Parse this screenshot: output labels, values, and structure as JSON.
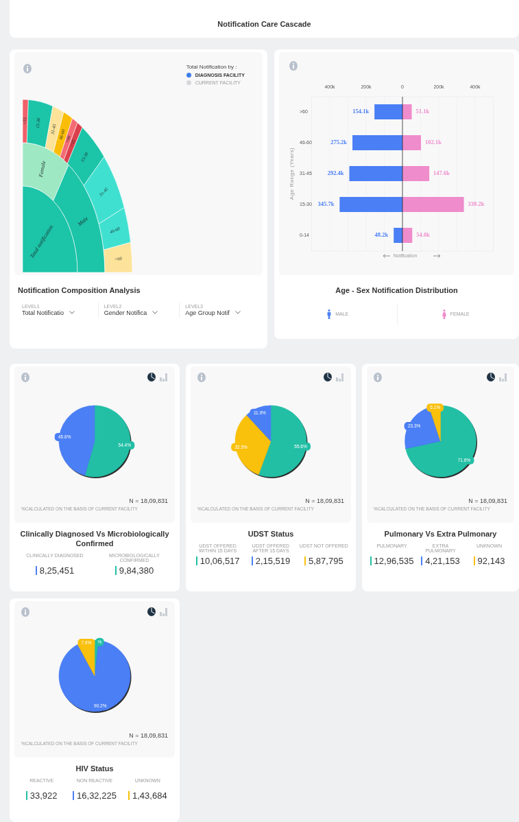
{
  "header": {
    "title": "Notification Care Cascade"
  },
  "composition": {
    "legend_title": "Total Notification by :",
    "legend": [
      {
        "label": "DIAGNOSIS FACILITY",
        "selected": true
      },
      {
        "label": "CURRENT FACILITY",
        "selected": false
      }
    ],
    "sunburst": {
      "rings": [
        [
          {
            "label": "Total notification",
            "color": "#1cc4a8"
          }
        ],
        [
          {
            "label": "Female",
            "color": "#9ee8c4"
          },
          {
            "label": "Male",
            "color": "#1cc4a8"
          }
        ],
        [
          {
            "label": "<15",
            "color": "#f2606a"
          },
          {
            "label": "15-30",
            "color": "#1cc4a8"
          },
          {
            "label": "31-45",
            "color": "#fde39a"
          },
          {
            "label": "46-60",
            "color": "#fbbd08"
          },
          {
            "label": ">60",
            "color": "#f36b74"
          },
          {
            "label": "<15",
            "color": "#dc3f4c"
          },
          {
            "label": "15-30",
            "color": "#1cc4a8"
          },
          {
            "label": "31-45",
            "color": "#40e0d0"
          },
          {
            "label": "46-60",
            "color": "#40e0d0"
          },
          {
            "label": ">60",
            "color": "#fde39a"
          }
        ]
      ]
    },
    "title": "Notification Composition Analysis",
    "selectors": [
      {
        "label": "LEVEL1",
        "value": "Total Notificatio"
      },
      {
        "label": "LEVEL2",
        "value": "Gender Notifica"
      },
      {
        "label": "LEVEL3",
        "value": "Age Group Notif"
      }
    ]
  },
  "age_sex": {
    "title": "Age - Sex Notification Distribution",
    "chart_data": {
      "type": "bar",
      "orientation": "horizontal",
      "xlabel": "Notification",
      "ylabel": "Age Range (Years)",
      "categories": [
        ">60",
        "46-60",
        "31-45",
        "15-30",
        "0-14"
      ],
      "stacked": true,
      "series": [
        {
          "name": "MALE",
          "color": "#4a7ff5",
          "values": [
            -154100,
            -275200,
            -292400,
            -345700,
            -48200
          ]
        },
        {
          "name": "FEMALE",
          "color": "#ef8ccb",
          "values": [
            51100,
            102100,
            147600,
            338200,
            54000
          ]
        }
      ],
      "xlim": [
        -500000,
        500000
      ],
      "xticks": [
        {
          "value": -400000,
          "label": "400k"
        },
        {
          "value": -200000,
          "label": "200k"
        },
        {
          "value": 0,
          "label": "0"
        },
        {
          "value": 200000,
          "label": "200k"
        },
        {
          "value": 400000,
          "label": "400k"
        }
      ]
    },
    "bar_labels": [
      {
        "male": "154.1k",
        "female": "51.1k"
      },
      {
        "male": "275.2k",
        "female": "102.1k"
      },
      {
        "male": "292.4k",
        "female": "147.6k"
      },
      {
        "male": "345.7k",
        "female": "338.2k"
      },
      {
        "male": "48.2k",
        "female": "54.0k"
      }
    ]
  },
  "cards": [
    {
      "title": "Clinically Diagnosed Vs Microbiologically Confirmed",
      "note": "%CALCULATED ON THE BASIS OF CURRENT FACILITY",
      "n": "N = 18,09,831",
      "views": [
        {
          "kind": "pie",
          "selected": true
        },
        {
          "kind": "bar",
          "selected": false
        }
      ],
      "chart_data": {
        "type": "pie",
        "values": [
          54.4,
          45.6
        ],
        "colors": [
          "#22bfa5",
          "#4a7ff5"
        ],
        "value_labels": [
          "54.4%",
          "45.6%"
        ]
      },
      "stats": [
        {
          "label": "CLINICALLY DIAGNOSED",
          "value": "8,25,451",
          "color": "#4a7ff5"
        },
        {
          "label": "MICROBIOLOGICALLY CONFIRMED",
          "value": "9,84,380",
          "color": "#22bfa5"
        }
      ]
    },
    {
      "title": "UDST Status",
      "note": "%CALCULATED ON THE BASIS OF CURRENT FACILITY",
      "n": "N = 18,09,831",
      "views": [
        {
          "kind": "pie",
          "selected": true
        },
        {
          "kind": "bar",
          "selected": false
        }
      ],
      "chart_data": {
        "type": "pie",
        "values": [
          55.6,
          32.5,
          11.9
        ],
        "colors": [
          "#22bfa5",
          "#f9c00c",
          "#4a7ff5"
        ],
        "value_labels": [
          "55.6%",
          "32.5%",
          "11.9%"
        ]
      },
      "stats": [
        {
          "label": "UDST OFFERED WITHIN 15 DAYS",
          "value": "10,06,517",
          "color": "#22bfa5"
        },
        {
          "label": "UDST OFFERED AFTER 15 DAYS",
          "value": "2,15,519",
          "color": "#4a7ff5"
        },
        {
          "label": "UDST NOT OFFERED",
          "value": "5,87,795",
          "color": "#f9c00c"
        }
      ]
    },
    {
      "title": "Pulmonary Vs Extra Pulmonary",
      "note": "%CALCULATED ON THE BASIS OF CURRENT FACILITY",
      "n": "N = 18,09,831",
      "views": [
        {
          "kind": "pie",
          "selected": true
        },
        {
          "kind": "bar",
          "selected": false
        }
      ],
      "chart_data": {
        "type": "pie",
        "values": [
          71.6,
          23.3,
          5.1
        ],
        "colors": [
          "#22bfa5",
          "#4a7ff5",
          "#f9c00c"
        ],
        "value_labels": [
          "71.6%",
          "23.3%",
          "5.1%"
        ]
      },
      "stats": [
        {
          "label": "PULMONARY",
          "value": "12,96,535",
          "color": "#22bfa5"
        },
        {
          "label": "EXTRA PULMONARY",
          "value": "4,21,153",
          "color": "#4a7ff5"
        },
        {
          "label": "UNKNOWN",
          "value": "92,143",
          "color": "#f9c00c"
        }
      ]
    },
    {
      "title": "HIV Status",
      "note": "%CALCULATED ON THE BASIS OF CURRENT FACILITY",
      "n": "N = 18,09,831",
      "views": [
        {
          "kind": "pie",
          "selected": true
        },
        {
          "kind": "bar",
          "selected": false
        }
      ],
      "chart_data": {
        "type": "pie",
        "values": [
          1.9,
          90.2,
          7.9
        ],
        "colors": [
          "#22bfa5",
          "#4a7ff5",
          "#f9c00c"
        ],
        "value_labels": [
          "%",
          "90.2%",
          "7.9%"
        ]
      },
      "stats": [
        {
          "label": "REACTIVE",
          "value": "33,922",
          "color": "#22bfa5"
        },
        {
          "label": "NON REACTIVE",
          "value": "16,32,225",
          "color": "#4a7ff5"
        },
        {
          "label": "UNKNOWN",
          "value": "1,43,684",
          "color": "#f9c00c"
        }
      ]
    }
  ]
}
